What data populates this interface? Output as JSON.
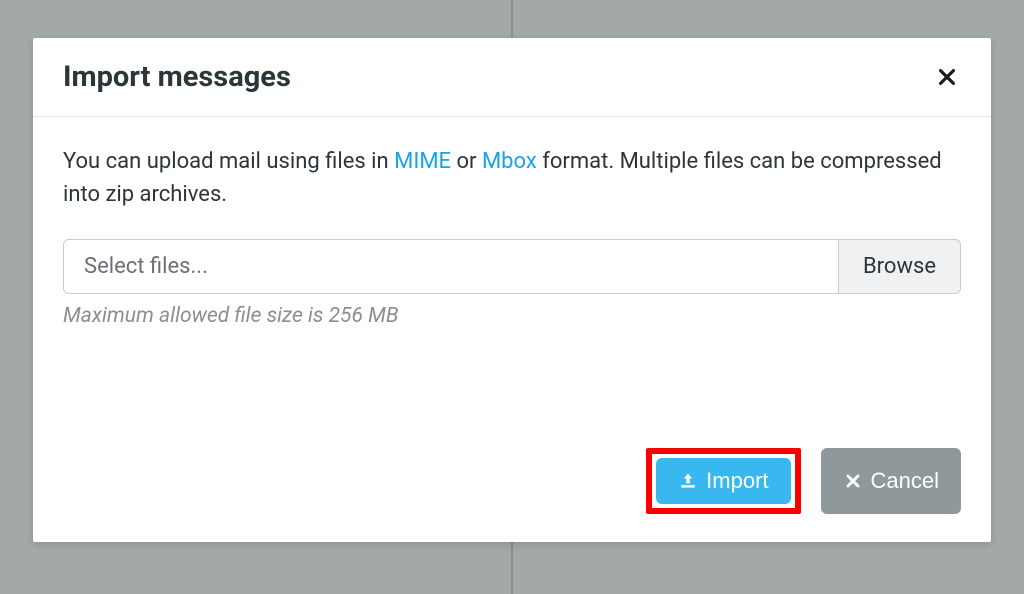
{
  "dialog": {
    "title": "Import messages",
    "instruction_pre": "You can upload mail using files in ",
    "link_mime": "MIME",
    "instruction_or": " or ",
    "link_mbox": "Mbox",
    "instruction_post": " format. Multiple files can be compressed into zip archives.",
    "file_placeholder": "Select files...",
    "browse_label": "Browse",
    "hint": "Maximum allowed file size is 256 MB",
    "import_label": "Import",
    "cancel_label": "Cancel"
  }
}
